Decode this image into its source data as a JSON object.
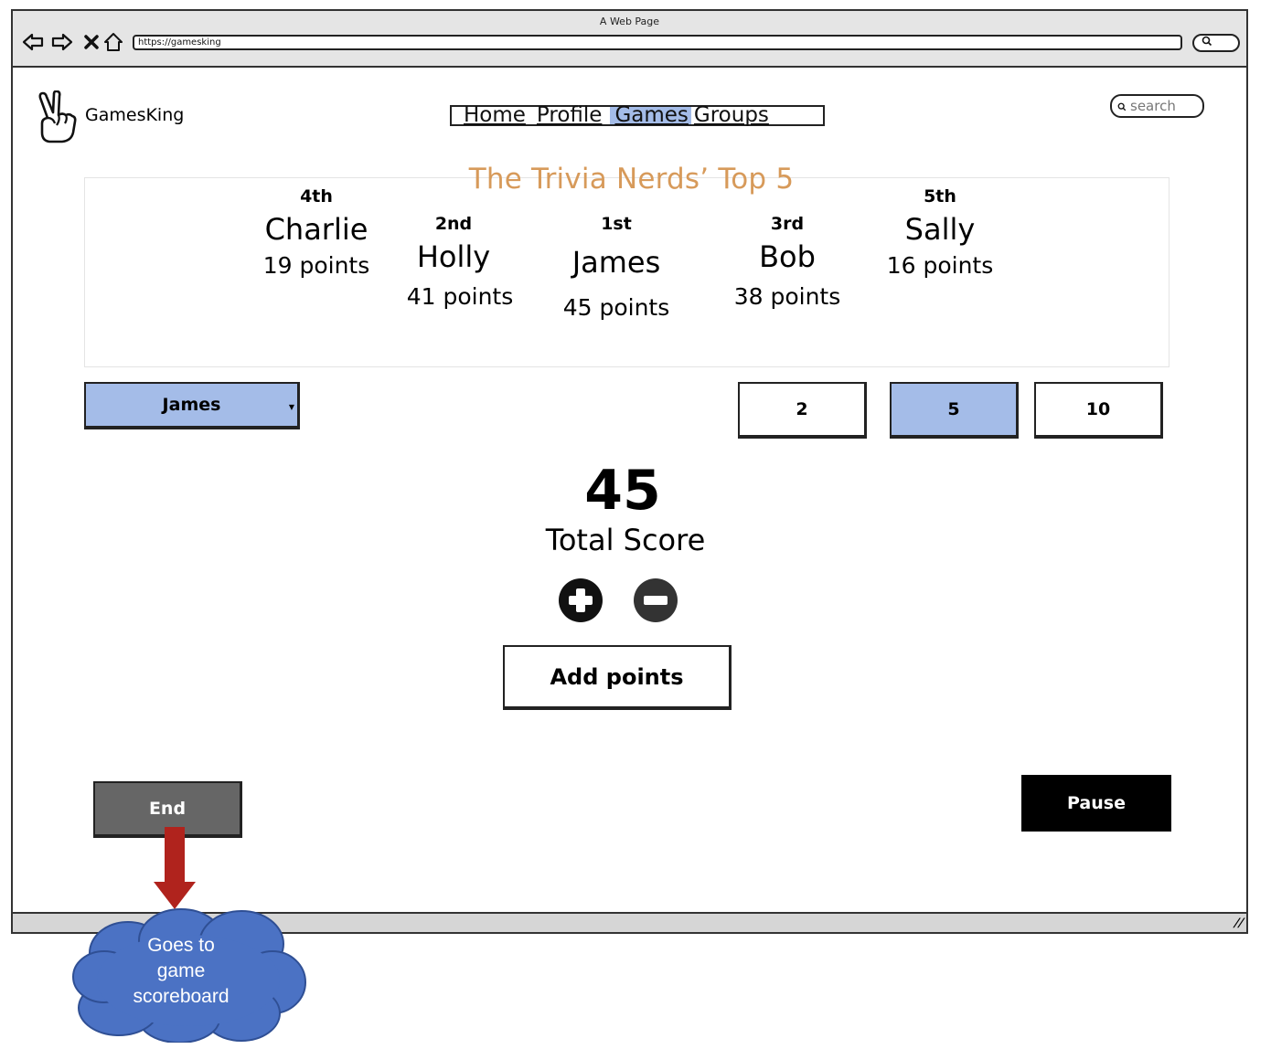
{
  "browser": {
    "title": "A Web Page",
    "url": "https://gamesking",
    "nav_icons": [
      "back-arrow-icon",
      "forward-arrow-icon",
      "close-icon",
      "home-icon"
    ]
  },
  "site": {
    "brand": "GamesKing",
    "nav": [
      {
        "label": "Home",
        "active": false
      },
      {
        "label": "Profile",
        "active": false
      },
      {
        "label": "Games",
        "active": true
      },
      {
        "label": "Groups",
        "active": false
      }
    ],
    "search_placeholder": "search"
  },
  "leaderboard": {
    "title": "The Trivia Nerds’ Top 5",
    "entries": [
      {
        "rank": "4th",
        "name": "Charlie",
        "points": "19 points"
      },
      {
        "rank": "2nd",
        "name": "Holly",
        "points": "41 points"
      },
      {
        "rank": "1st",
        "name": "James",
        "points": "45 points"
      },
      {
        "rank": "3rd",
        "name": "Bob",
        "points": "38 points"
      },
      {
        "rank": "5th",
        "name": "Sally",
        "points": "16 points"
      }
    ]
  },
  "scoring": {
    "selected_player": "James",
    "increments": [
      {
        "label": "2",
        "selected": false
      },
      {
        "label": "5",
        "selected": true
      },
      {
        "label": "10",
        "selected": false
      }
    ],
    "total_score": "45",
    "total_label": "Total Score",
    "add_points_label": "Add points"
  },
  "actions": {
    "end_label": "End",
    "pause_label": "Pause"
  },
  "annotation": {
    "callout_line1": "Goes to",
    "callout_line2": "game",
    "callout_line3": "scoreboard"
  },
  "colors": {
    "accent_blue": "#a4bce8",
    "title_orange": "#d79a5a",
    "callout_blue": "#4b72c4",
    "arrow_red": "#b0231d",
    "end_gray": "#666666"
  }
}
